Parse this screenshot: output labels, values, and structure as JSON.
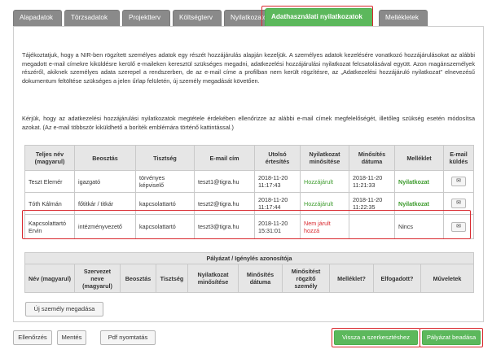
{
  "tabs": [
    {
      "label": "Alapadatok"
    },
    {
      "label": "Törzsadatok"
    },
    {
      "label": "Projektterv"
    },
    {
      "label": "Költségterv"
    },
    {
      "label": "Nyilatkozatok"
    },
    {
      "label": "Adathasználati nyilatkozatok"
    },
    {
      "label": "Mellékletek"
    }
  ],
  "intro": {
    "paragraph1": "Tájékoztatjuk, hogy a NIR-ben rögzített személyes adatok egy részét hozzájárulás alapján kezeljük. A személyes adatok kezelésére vonatkozó hozzájárulásokat az alábbi megadott e-mail címekre kiküldésre kerülő e-maileken keresztül szükséges megadni, adatkezelési hozzájárulási nyilatkozat felcsatolásával együtt. Azon magánszemélyek részéről, akiknek személyes adata szerepel a rendszerben, de az e-mail címe a profilban nem került rögzítésre, az „Adatkezelési hozzájáruló nyilatkozat” elnevezésű dokumentum feltöltése szükséges a jelen űrlap felületén, új személy megadását követően.",
    "paragraph2": "Kérjük, hogy az adatkezelési hozzájárulási nyilatkozatok megtétele érdekében ellenőrizze az alábbi e-mail címek megfelelőségét, illetőleg szükség esetén módosítsa azokat. (Az e-mail többször kiküldhető a boríték emblémára történő kattintással.)"
  },
  "consent_table": {
    "headers": [
      "Teljes név (magyarul)",
      "Beosztás",
      "Tisztség",
      "E-mail cím",
      "Utolsó értesítés",
      "Nyilatkozat minősítése",
      "Minősítés dátuma",
      "Melléklet",
      "E-mail küldés"
    ],
    "rows": [
      {
        "name": "Teszt Elemér",
        "position": "igazgató",
        "title": "törvényes képviselő",
        "email": "teszt1@tigra.hu",
        "last_notice": "2018-11-20 11:17:43",
        "status": "Hozzájárult",
        "status_date": "2018-11-20 11:21:33",
        "attachment": "Nyilatkozat",
        "send_icon": "envelope-icon"
      },
      {
        "name": "Tóth Kálmán",
        "position": "főtitkár / titkár",
        "title": "kapcsolattartó",
        "email": "teszt2@tigra.hu",
        "last_notice": "2018-11-20 11:17:44",
        "status": "Hozzájárult",
        "status_date": "2018-11-20 11:22:35",
        "attachment": "Nyilatkozat",
        "send_icon": "envelope-icon"
      },
      {
        "name": "Kapcsolattartó Ervin",
        "position": "intézményvezető",
        "title": "kapcsolattartó",
        "email": "teszt3@tigra.hu",
        "last_notice": "2018-11-20 15:31:01",
        "status": "Nem járult hozzá",
        "status_date": "",
        "attachment": "Nincs",
        "send_icon": "envelope-icon"
      }
    ]
  },
  "applicant_table": {
    "title": "Pályázat / Igénylés azonosítója",
    "headers": [
      "Név (magyarul)",
      "Szervezet neve (magyarul)",
      "Beosztás",
      "Tisztség",
      "Nyilatkozat minősítése",
      "Minősítés dátuma",
      "Minősítést rögzítő személy",
      "Melléklet?",
      "Elfogadott?",
      "Műveletek"
    ]
  },
  "buttons": {
    "new_person": "Új személy megadása",
    "check": "Ellenőrzés",
    "save": "Mentés",
    "pdf_print": "Pdf nyomtatás",
    "back_to_edit": "Vissza a szerkesztéshez",
    "submit": "Pályázat beadása"
  },
  "colors": {
    "accent_green": "#5cb85c",
    "highlight_red": "#d9282e",
    "tab_gray": "#8a8a8a"
  }
}
